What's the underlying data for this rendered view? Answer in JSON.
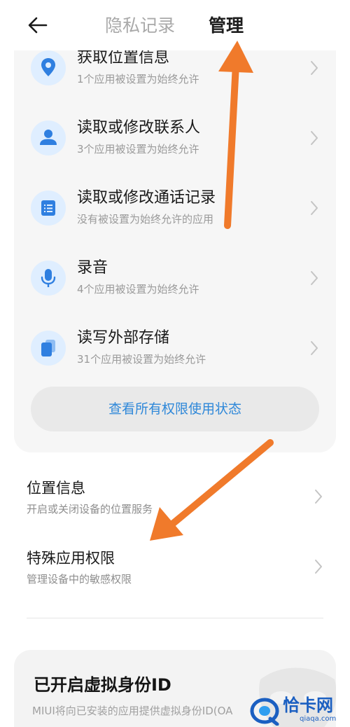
{
  "header": {
    "back_icon": "arrow-left-icon",
    "tabs": [
      {
        "label": "隐私记录",
        "active": false
      },
      {
        "label": "管理",
        "active": true
      }
    ]
  },
  "permissions": [
    {
      "icon": "location-pin-icon",
      "title": "获取位置信息",
      "subtitle": "1个应用被设置为始终允许"
    },
    {
      "icon": "contact-person-icon",
      "title": "读取或修改联系人",
      "subtitle": "3个应用被设置为始终允许"
    },
    {
      "icon": "call-log-icon",
      "title": "读取或修改通话记录",
      "subtitle": "没有被设置为始终允许的应用"
    },
    {
      "icon": "microphone-icon",
      "title": "录音",
      "subtitle": "4个应用被设置为始终允许"
    },
    {
      "icon": "storage-files-icon",
      "title": "读写外部存储",
      "subtitle": "31个应用被设置为始终允许"
    }
  ],
  "view_all_button": "查看所有权限使用状态",
  "settings": [
    {
      "title": "位置信息",
      "subtitle": "开启或关闭设备的位置服务"
    },
    {
      "title": "特殊应用权限",
      "subtitle": "管理设备中的敏感权限"
    }
  ],
  "virtual_id": {
    "title": "已开启虚拟身份ID",
    "description": "MIUI将向已安装的应用提供虚拟身份ID(OA"
  },
  "watermark": {
    "name": "恰卡网",
    "url": "qiaqa.com"
  },
  "colors": {
    "accent": "#2f88d9",
    "annotation_arrow": "#f07a2b",
    "icon_bg": "#dfeeff",
    "icon_fg": "#2f7fe0"
  }
}
